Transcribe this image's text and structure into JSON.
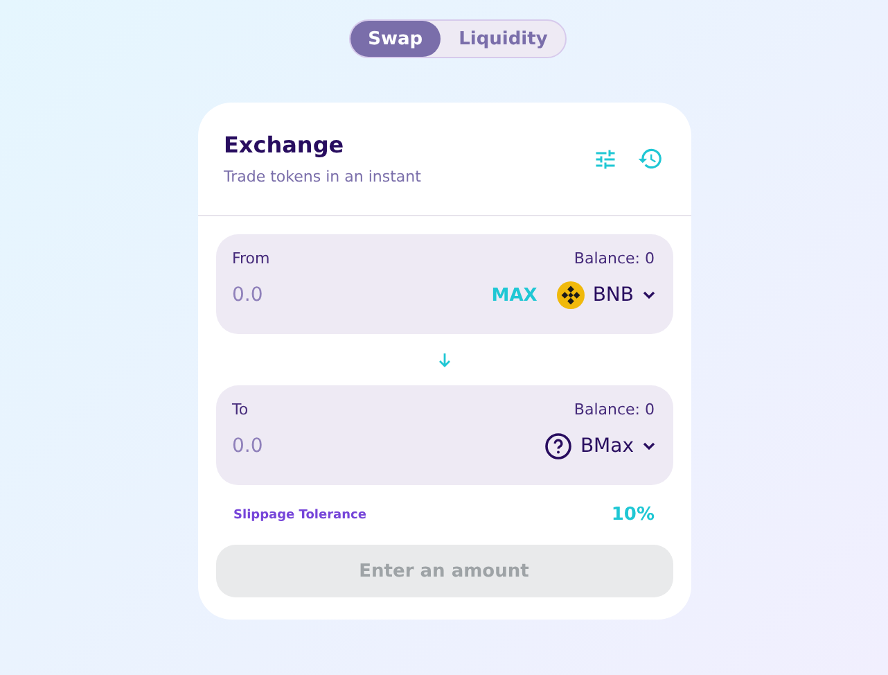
{
  "tabs": [
    {
      "label": "Swap",
      "selected": true
    },
    {
      "label": "Liquidity",
      "selected": false
    }
  ],
  "header": {
    "title": "Exchange",
    "subtitle": "Trade tokens in an instant"
  },
  "panels": [
    {
      "label": "From",
      "balance": "Balance: 0",
      "placeholder": "0.0",
      "max": "MAX",
      "token": {
        "symbol": "BNB",
        "kind": "bnb"
      }
    },
    {
      "label": "To",
      "balance": "Balance: 0",
      "placeholder": "0.0",
      "token": {
        "symbol": "BMax",
        "kind": "unknown"
      }
    }
  ],
  "slippage": {
    "label": "Slippage Tolerance",
    "value": "10%"
  },
  "submit": {
    "label": "Enter an amount",
    "disabled": true
  }
}
